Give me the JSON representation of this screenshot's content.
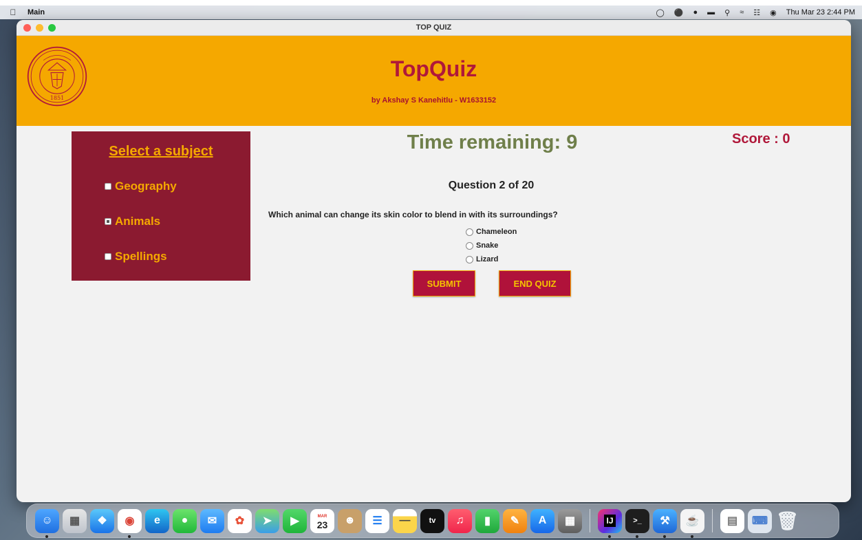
{
  "menubar": {
    "app_name": "Main",
    "datetime": "Thu Mar 23  2:44 PM"
  },
  "window": {
    "title": "TOP QUIZ"
  },
  "header": {
    "title": "TopQuiz",
    "author": "by Akshay S Kanehitlu - W1633152",
    "seal_year": "1851"
  },
  "subjects": {
    "heading": "Select a subject",
    "items": [
      {
        "label": "Geography",
        "checked": false
      },
      {
        "label": "Animals",
        "checked": true
      },
      {
        "label": "Spellings",
        "checked": false
      }
    ]
  },
  "quiz": {
    "timer": "Time remaining: 9",
    "score": "Score : 0",
    "question_count": "Question 2 of 20",
    "question": "Which animal can change its skin color to blend in with its surroundings?",
    "options": [
      "Chameleon",
      "Snake",
      "Lizard"
    ],
    "submit_label": "SUBMIT",
    "end_label": "END QUIZ"
  },
  "dock": {
    "calendar_day": "23",
    "calendar_month": "MAR",
    "tv_label": "tv",
    "ij_label": "IJ"
  },
  "colors": {
    "header_gold": "#f5a800",
    "panel_maroon": "#8b1a30",
    "title_red": "#b0183a",
    "timer_olive": "#6f7f4a"
  }
}
